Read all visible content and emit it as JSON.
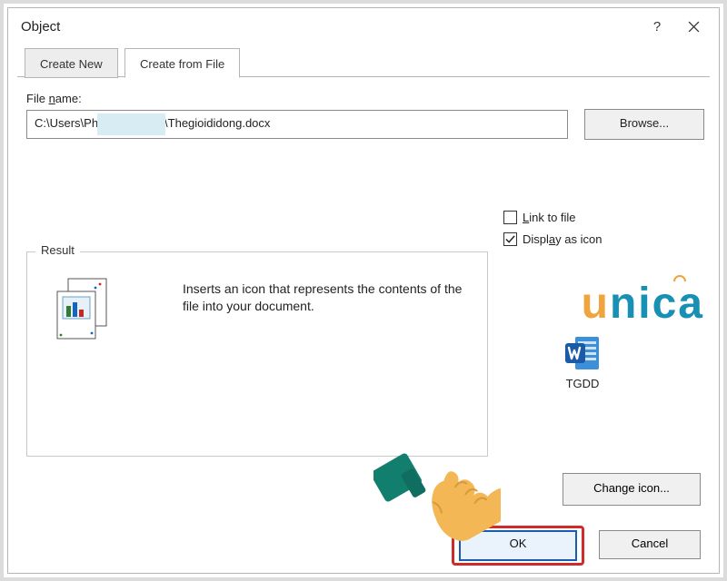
{
  "title": "Object",
  "tabs": {
    "inactive": "Create New",
    "active": "Create from File"
  },
  "file": {
    "label": "File name:",
    "path_visible": "C:\\Users\\Ph              \\Documents\\Thegioididong.docx",
    "browse_label": "Browse..."
  },
  "options": {
    "link_label": "Link to file",
    "link_checked": false,
    "icon_label": "Display as icon",
    "icon_checked": true
  },
  "result": {
    "legend": "Result",
    "description": "Inserts an icon that represents the contents of the file into your document."
  },
  "preview": {
    "caption": "TGDD"
  },
  "buttons": {
    "change_icon": "Change icon...",
    "ok": "OK",
    "cancel": "Cancel"
  },
  "titlebar": {
    "help": "?"
  },
  "watermark": {
    "text": "unica"
  }
}
